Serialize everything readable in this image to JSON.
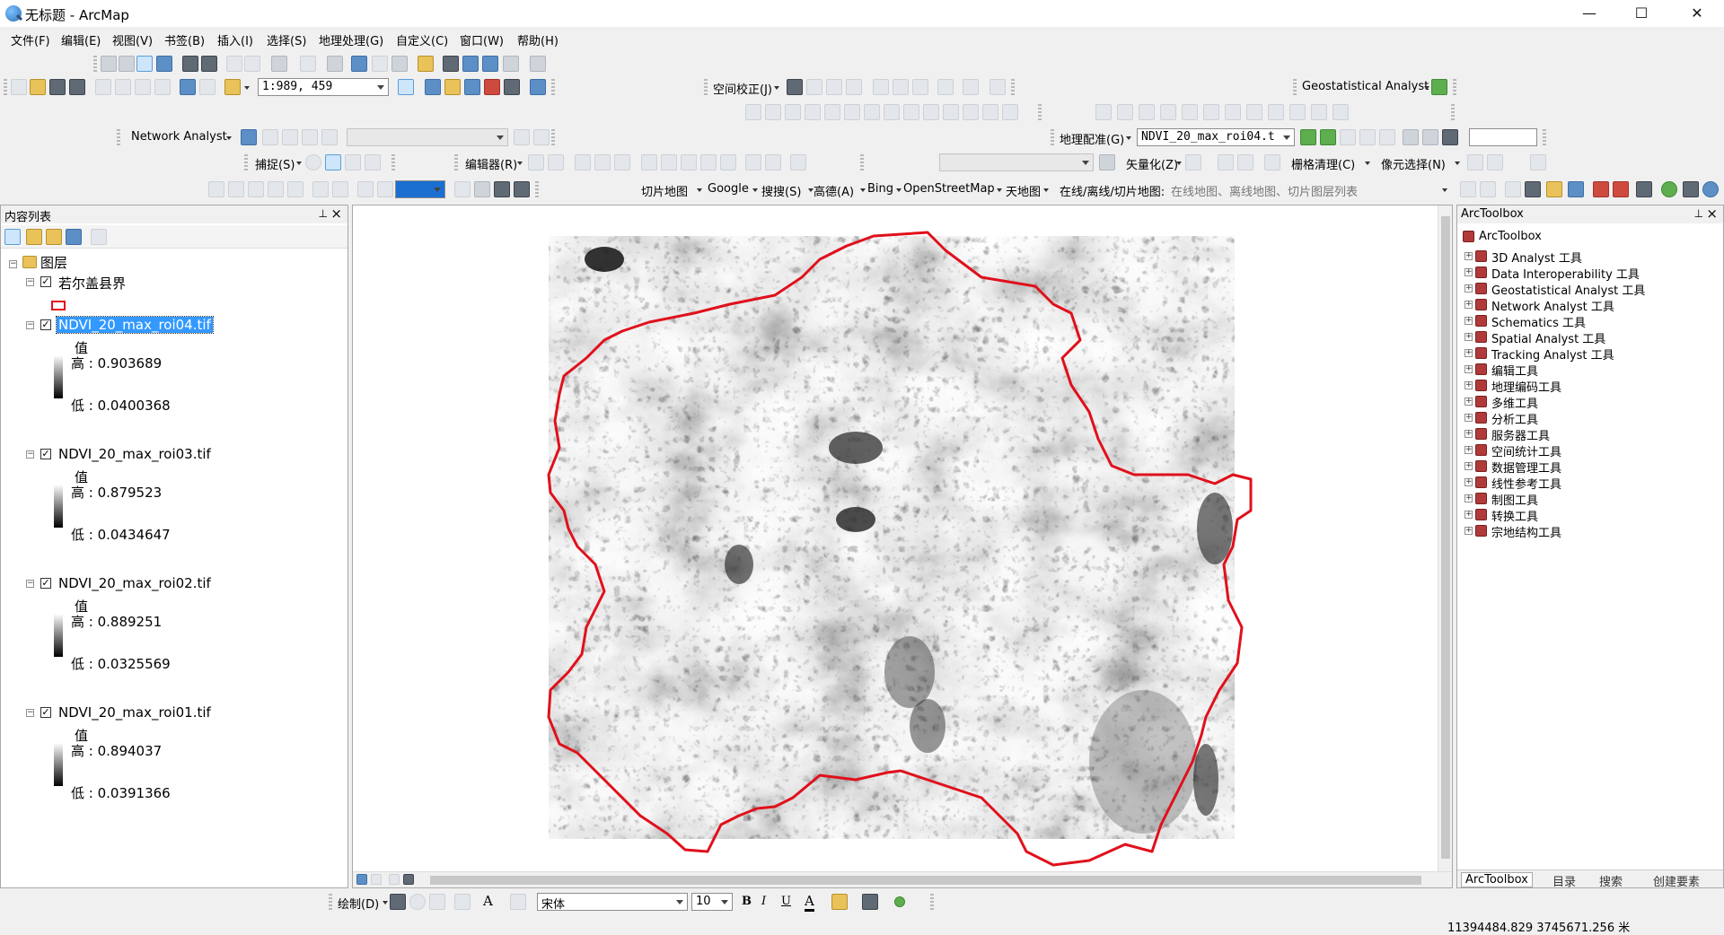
{
  "window": {
    "title": "无标题 - ArcMap",
    "minimize": "—",
    "maximize": "☐",
    "close": "✕"
  },
  "menu": [
    "文件(F)",
    "编辑(E)",
    "视图(V)",
    "书签(B)",
    "插入(I)",
    "选择(S)",
    "地理处理(G)",
    "自定义(C)",
    "窗口(W)",
    "帮助(H)"
  ],
  "toolbars": {
    "scale": "1:989, 459",
    "spatial_adjust": "空间校正(J)",
    "geostat": "Geostatistical Analyst",
    "network": "Network Analyst",
    "georef": "地理配准(G)",
    "georef_layer": "NDVI_20_max_roi04.t",
    "snapping": "捕捉(S)",
    "editor": "编辑器(R)",
    "vectorize": "矢量化(Z)",
    "raster_cleanup": "栅格清理(C)",
    "pixel_select": "像元选择(N)",
    "tiles": "切片地图",
    "google": "Google",
    "sousou": "搜搜(S)",
    "gaode": "高德(A)",
    "bing": "Bing",
    "osm": "OpenStreetMap",
    "tianditu": "天地图",
    "online_label": "在线/离线/切片地图:",
    "online_desc": "在线地图、离线地图、切片图层列表"
  },
  "toc": {
    "title": "内容列表",
    "root": "图层",
    "layers": [
      {
        "name": "若尔盖县界",
        "kind": "vector"
      },
      {
        "name": "NDVI_20_max_roi04.tif",
        "value_label": "值",
        "high": "高 : 0.903689",
        "low": "低 : 0.0400368",
        "selected": true
      },
      {
        "name": "NDVI_20_max_roi03.tif",
        "value_label": "值",
        "high": "高 : 0.879523",
        "low": "低 : 0.0434647"
      },
      {
        "name": "NDVI_20_max_roi02.tif",
        "value_label": "值",
        "high": "高 : 0.889251",
        "low": "低 : 0.0325569"
      },
      {
        "name": "NDVI_20_max_roi01.tif",
        "value_label": "值",
        "high": "高 : 0.894037",
        "low": "低 : 0.0391366"
      }
    ]
  },
  "toolbox": {
    "title": "ArcToolbox",
    "root": "ArcToolbox",
    "items": [
      "3D Analyst 工具",
      "Data Interoperability 工具",
      "Geostatistical Analyst 工具",
      "Network Analyst 工具",
      "Schematics 工具",
      "Spatial Analyst 工具",
      "Tracking Analyst 工具",
      "编辑工具",
      "地理编码工具",
      "多维工具",
      "分析工具",
      "服务器工具",
      "空间统计工具",
      "数据管理工具",
      "线性参考工具",
      "制图工具",
      "转换工具",
      "宗地结构工具"
    ],
    "tabs": [
      "ArcToolbox",
      "目录",
      "搜索",
      "创建要素"
    ]
  },
  "draw_toolbar": {
    "draw": "绘制(D)",
    "font": "宋体",
    "size": "10",
    "bold": "B",
    "italic": "I",
    "underline": "U",
    "font_color": "A"
  },
  "status": {
    "coords": "11394484.829  3745671.256 米"
  },
  "colors": {
    "boundary": "#e0101b",
    "selection": "#3399ff"
  }
}
